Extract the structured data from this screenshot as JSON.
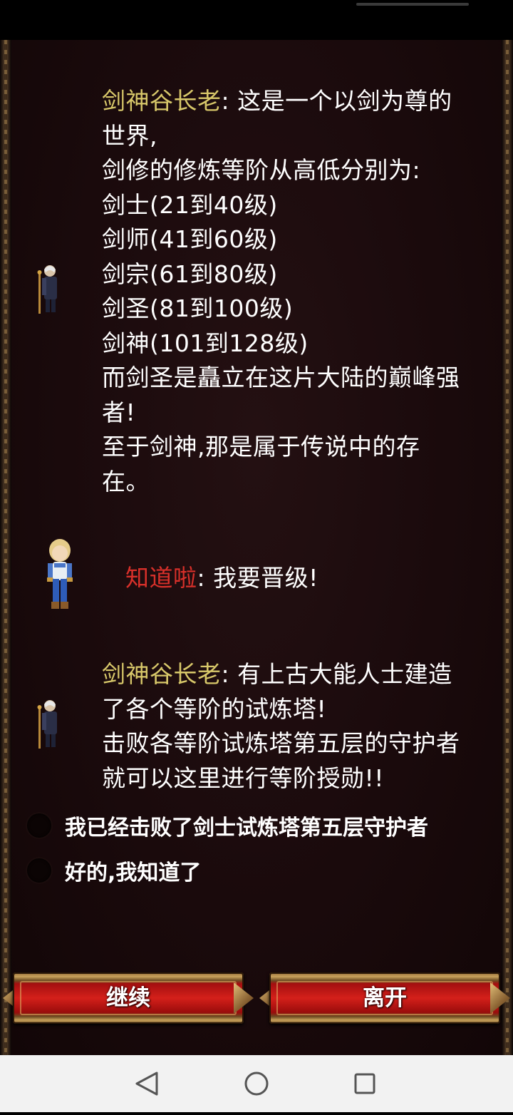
{
  "dialog": {
    "messages": [
      {
        "speaker": "剑神谷长老",
        "lines": [
          ": 这是一个以剑为尊的",
          "世界,",
          "剑修的修炼等阶从高低分别为:",
          "剑士(21到40级)",
          "剑师(41到60级)",
          "剑宗(61到80级)",
          "剑圣(81到100级)",
          "剑神(101到128级)",
          "而剑圣是矗立在这片大陆的巅峰强",
          "者!",
          "至于剑神,那是属于传说中的存",
          "在。"
        ],
        "avatar": "elder-npc-sprite"
      },
      {
        "speaker": "知道啦",
        "lines": [
          ": 我要晋级!"
        ],
        "avatar": "player-character-sprite"
      },
      {
        "speaker": "剑神谷长老",
        "lines": [
          ": 有上古大能人士建造",
          "了各个等阶的试炼塔!",
          "击败各等阶试炼塔第五层的守护者",
          "就可以这里进行等阶授勋!!"
        ],
        "avatar": "elder-npc-sprite"
      }
    ],
    "choices": [
      {
        "label": "我已经击败了剑士试炼塔第五层守护者"
      },
      {
        "label": "好的,我知道了"
      }
    ]
  },
  "buttons": {
    "continue_label": "继续",
    "leave_label": "离开"
  },
  "navigation": {
    "back": "back-triangle-icon",
    "home": "home-circle-icon",
    "recents": "recents-square-icon"
  },
  "colors": {
    "elder_name": "#d8c86a",
    "player_name": "#d8302a",
    "background": "#1a0a0c"
  }
}
